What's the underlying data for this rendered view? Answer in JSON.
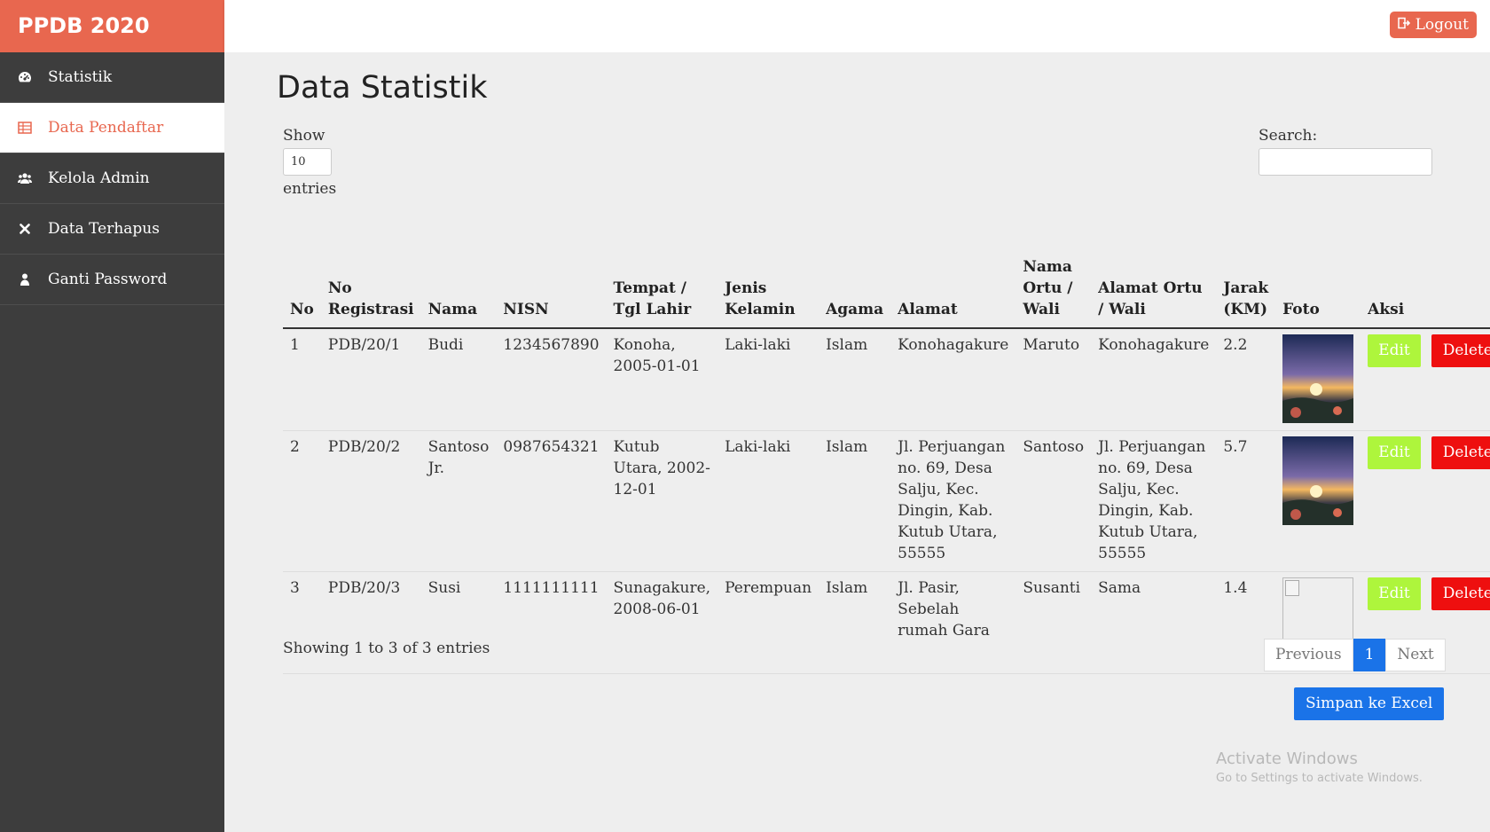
{
  "brand": "PPDB 2020",
  "sidebar": {
    "items": [
      {
        "label": "Statistik",
        "icon": "dashboard-icon"
      },
      {
        "label": "Data Pendaftar",
        "icon": "table-icon"
      },
      {
        "label": "Kelola Admin",
        "icon": "users-icon"
      },
      {
        "label": "Data Terhapus",
        "icon": "close-icon"
      },
      {
        "label": "Ganti Password",
        "icon": "user-icon"
      }
    ]
  },
  "topbar": {
    "logout_label": "Logout"
  },
  "page": {
    "title": "Data Statistik"
  },
  "datatable": {
    "length": {
      "show": "Show",
      "value": "10",
      "entries": "entries"
    },
    "search_label": "Search:",
    "columns": [
      "No",
      "No Registrasi",
      "Nama",
      "NISN",
      "Tempat / Tgl Lahir",
      "Jenis Kelamin",
      "Agama",
      "Alamat",
      "Nama Ortu / Wali",
      "Alamat Ortu / Wali",
      "Jarak (KM)",
      "Foto",
      "Aksi"
    ],
    "rows": [
      {
        "no": "1",
        "reg": "PDB/20/1",
        "nama": "Budi",
        "nisn": "1234567890",
        "ttl": "Konoha, 2005-01-01",
        "jk": "Laki-laki",
        "agama": "Islam",
        "alamat": "Konohagakure",
        "ortu": "Maruto",
        "alamat_ortu": "Konohagakure",
        "jarak": "2.2",
        "has_photo": true
      },
      {
        "no": "2",
        "reg": "PDB/20/2",
        "nama": "Santoso Jr.",
        "nisn": "0987654321",
        "ttl": "Kutub Utara, 2002-12-01",
        "jk": "Laki-laki",
        "agama": "Islam",
        "alamat": "Jl. Perjuangan no. 69, Desa Salju, Kec. Dingin, Kab. Kutub Utara, 55555",
        "ortu": "Santoso",
        "alamat_ortu": "Jl. Perjuangan no. 69, Desa Salju, Kec. Dingin, Kab. Kutub Utara, 55555",
        "jarak": "5.7",
        "has_photo": true
      },
      {
        "no": "3",
        "reg": "PDB/20/3",
        "nama": "Susi",
        "nisn": "1111111111",
        "ttl": "Sunagakure, 2008-06-01",
        "jk": "Perempuan",
        "agama": "Islam",
        "alamat": "Jl. Pasir, Sebelah rumah Gara",
        "ortu": "Susanti",
        "alamat_ortu": "Sama",
        "jarak": "1.4",
        "has_photo": false
      }
    ],
    "edit_label": "Edit",
    "delete_label": "Delete",
    "info": "Showing 1 to 3 of 3 entries",
    "pager": {
      "prev": "Previous",
      "current": "1",
      "next": "Next"
    },
    "excel_label": "Simpan ke Excel"
  },
  "watermark": {
    "line1": "Activate Windows",
    "line2": "Go to Settings to activate Windows."
  },
  "colors": {
    "brand": "#e8674f",
    "sidebar": "#3d3d3d",
    "edit": "#aef53c",
    "delete": "#ee0f0f",
    "primary": "#1a73e8"
  }
}
